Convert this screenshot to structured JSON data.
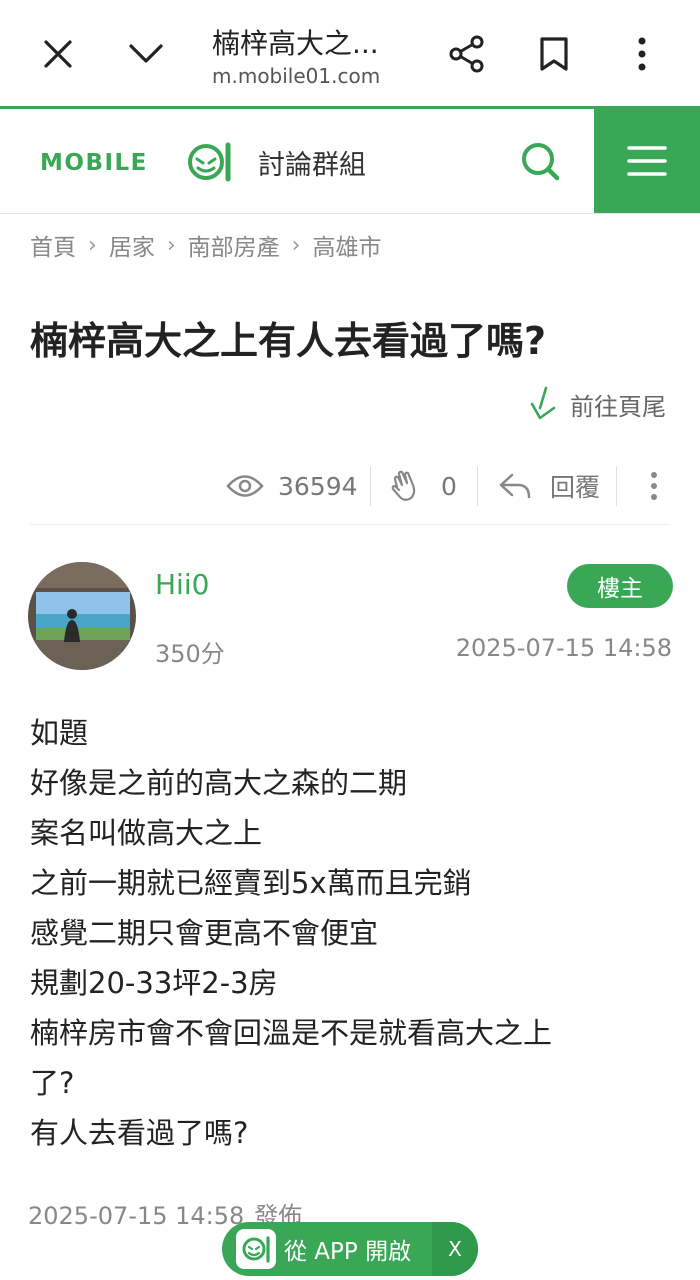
{
  "browser": {
    "tab_title": "楠梓高大之...",
    "url": "m.mobile01.com"
  },
  "site": {
    "logo_text": "MOBILE01",
    "section_label": "討論群組",
    "brand_color": "#3aa757"
  },
  "breadcrumb": [
    "首頁",
    "居家",
    "南部房產",
    "高雄市"
  ],
  "post": {
    "title": "楠梓高大之上有人去看過了嗎?",
    "goto_end_label": "前往頁尾",
    "views": "36594",
    "likes": "0",
    "reply_label": "回覆",
    "author": {
      "name": "Hii0",
      "score": "350分",
      "badge": "樓主"
    },
    "time": "2025-07-15 14:58",
    "body_lines": [
      "如題",
      "好像是之前的高大之森的二期",
      "案名叫做高大之上",
      "之前一期就已經賣到5x萬而且完銷",
      "感覺二期只會更高不會便宜",
      "規劃20-33坪2-3房",
      "楠梓房市會不會回溫是不是就看高大之上",
      "了?",
      "有人去看過了嗎?"
    ],
    "published_time": "2025-07-15 14:58",
    "published_label": "發佈"
  },
  "app_banner": {
    "label": "從 APP 開啟",
    "close": "X"
  },
  "icons": [
    "close-icon",
    "chevron-down-icon",
    "share-icon",
    "bookmark-icon",
    "more-vert-icon",
    "search-icon",
    "menu-icon",
    "arrow-down-icon",
    "eye-icon",
    "clap-icon",
    "reply-icon",
    "app-icon"
  ]
}
